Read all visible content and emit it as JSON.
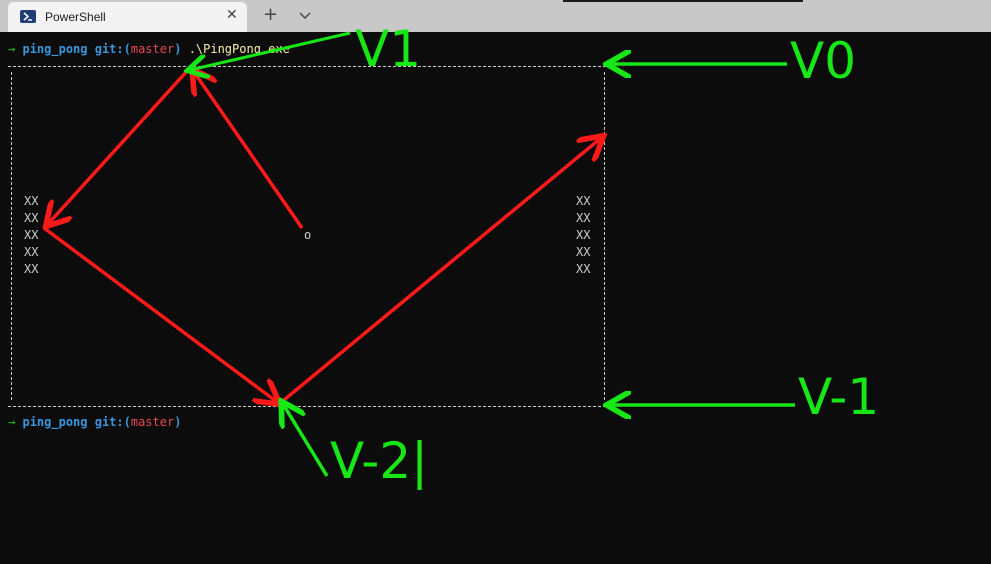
{
  "tab": {
    "title": "PowerShell",
    "close_glyph": "✕",
    "new_tab_glyph": "+",
    "icon": "powershell-icon"
  },
  "prompt1": {
    "arrow": "→",
    "dir": "ping_pong",
    "git_prefix": "git:(",
    "branch": "master",
    "git_suffix": ")",
    "command": ".\\PingPong.exe"
  },
  "prompt2": {
    "arrow": "→",
    "dir": "ping_pong",
    "git_prefix": "git:(",
    "branch": "master",
    "git_suffix": ")"
  },
  "game": {
    "left_paddle": "XX\nXX\nXX\nXX\nXX",
    "right_paddle": "XX\nXX\nXX\nXX\nXX",
    "ball": "o"
  },
  "annotations": {
    "v1": "V1",
    "v0": "V0",
    "v_minus_1": "V-1",
    "v_minus_2": "V-2|"
  },
  "colors": {
    "annotation": "#17e617",
    "trajectory": "#ff1a1a",
    "background": "#0c0c0c"
  }
}
